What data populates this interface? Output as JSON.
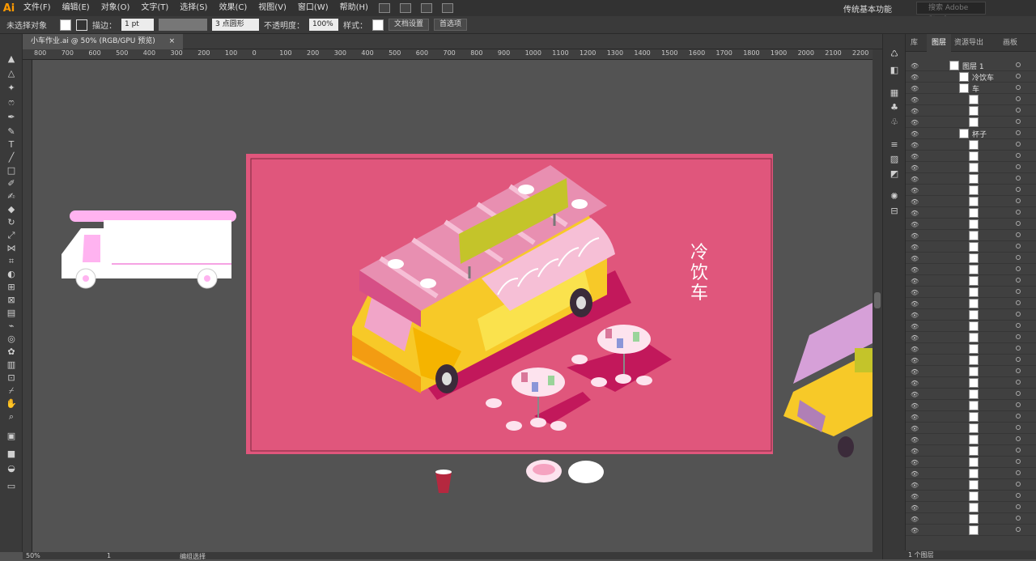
{
  "app": {
    "logo": "Ai",
    "menus": [
      "文件(F)",
      "编辑(E)",
      "对象(O)",
      "文字(T)",
      "选择(S)",
      "效果(C)",
      "视图(V)",
      "窗口(W)",
      "帮助(H)"
    ],
    "workspace": "传统基本功能",
    "stock_placeholder": "搜索 Adobe Stock"
  },
  "control": {
    "selection": "未选择对象",
    "stroke_label": "描边：",
    "stroke_value": "1 pt",
    "brush": "3 点圆形",
    "opacity_label": "不透明度：",
    "opacity_value": "100%",
    "style_label": "样式：",
    "doc_setup": "文档设置",
    "prefs": "首选项"
  },
  "doc": {
    "tab": "小车作业.ai @ 50% (RGB/GPU 预览)",
    "close": "×"
  },
  "ruler": [
    "800",
    "700",
    "600",
    "500",
    "400",
    "300",
    "200",
    "100",
    "0",
    "100",
    "200",
    "300",
    "400",
    "500",
    "600",
    "700",
    "800",
    "900",
    "1000",
    "1100",
    "1200",
    "1300",
    "1400",
    "1500",
    "1600",
    "1700",
    "1800",
    "1900",
    "2000",
    "2100",
    "2200"
  ],
  "canvas": {
    "title_text": "冷饮车"
  },
  "status": {
    "zoom": "50%",
    "page": "1",
    "mode": "编组选择"
  },
  "panel": {
    "tabs": [
      "库",
      "图层",
      "资源导出",
      "画板"
    ],
    "layers": [
      {
        "name": "图层 1",
        "level": 0
      },
      {
        "name": "冷饮车",
        "level": 1
      },
      {
        "name": "车",
        "level": 1
      },
      {
        "name": "",
        "level": 2
      },
      {
        "name": "",
        "level": 2
      },
      {
        "name": "",
        "level": 2
      },
      {
        "name": "杯子",
        "level": 1
      }
    ],
    "footer": "1 个图层"
  },
  "colors": {
    "artboard": "#e0567c",
    "awning": "#e88fb1",
    "truck_yellow": "#f7c928",
    "sign": "#c4c42a",
    "table": "#fde3ee"
  }
}
